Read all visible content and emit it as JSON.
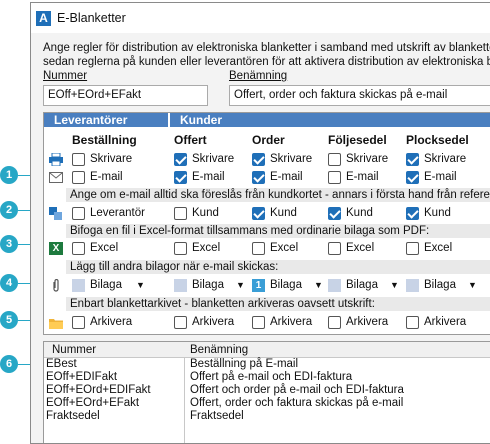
{
  "window": {
    "title": "E-Blanketter"
  },
  "description": {
    "line1": "Ange regler för distribution av elektroniska blanketter i samband med utskrift av blanketter.",
    "line2": "sedan reglerna på kunden eller leverantören för att aktivera distribution av elektroniska blanketter."
  },
  "form": {
    "nummer_label": "Nummer",
    "nummer_value": "EOff+EOrd+EFakt",
    "benamning_label": "Benämning",
    "benamning_value": "Offert, order och faktura skickas på e-mail"
  },
  "grid": {
    "group_leverantorer": "Leverantörer",
    "group_kunder": "Kunder",
    "columns": [
      "Beställning",
      "Offert",
      "Order",
      "Följesedel",
      "Plocksedel"
    ],
    "rows": {
      "skrivare": {
        "label": "Skrivare",
        "checked": [
          false,
          true,
          true,
          false,
          true
        ]
      },
      "email": {
        "label": "E-mail",
        "checked": [
          false,
          true,
          true,
          false,
          true
        ]
      },
      "ref_note": "Ange om e-mail alltid ska föreslås från kundkortet - annars i första hand från referens:",
      "ref": {
        "labels": [
          "Leverantör",
          "Kund",
          "Kund",
          "Kund",
          "Kund"
        ],
        "checked": [
          false,
          false,
          true,
          true,
          true
        ]
      },
      "excel_note": "Bifoga en fil i Excel-format tillsammans med ordinarie bilaga som PDF:",
      "excel": {
        "label": "Excel",
        "checked": [
          false,
          false,
          false,
          false,
          false
        ]
      },
      "attach_note": "Lägg till andra bilagor när e-mail skickas:",
      "attach": {
        "label": "Bilaga",
        "dropdown": "▼",
        "numbered_text": "1"
      },
      "archive_note": "Enbart blankettarkivet - blanketten arkiveras oavsett utskrift:",
      "archive": {
        "label": "Arkivera",
        "checked": [
          false,
          false,
          false,
          false,
          false
        ]
      }
    }
  },
  "list": {
    "headers": [
      "Nummer",
      "Benämning"
    ],
    "rows": [
      {
        "nummer": "EBest",
        "benamning": "Beställning på E-mail"
      },
      {
        "nummer": "EOff+EDIFakt",
        "benamning": "Offert på e-mail och EDI-faktura"
      },
      {
        "nummer": "EOff+EOrd+EDIFakt",
        "benamning": "Offert och order på e-mail och EDI-faktura"
      },
      {
        "nummer": "EOff+EOrd+EFakt",
        "benamning": "Offert, order och faktura skickas på e-mail"
      },
      {
        "nummer": "Fraktsedel",
        "benamning": "Fraktsedel"
      }
    ]
  },
  "callouts": [
    "1",
    "2",
    "3",
    "4",
    "5",
    "6"
  ],
  "colors": {
    "accent": "#1f6fb8",
    "band": "#4a7fc0",
    "callout": "#27a7c6"
  }
}
